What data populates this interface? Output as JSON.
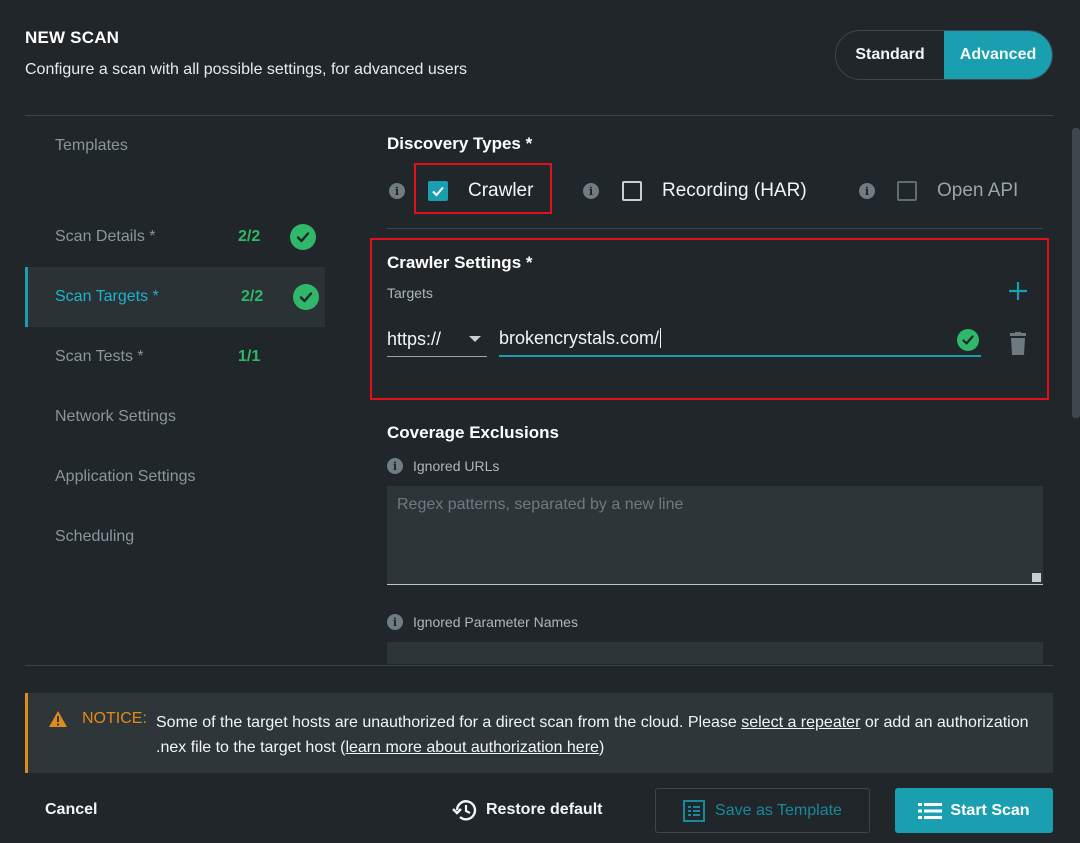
{
  "header": {
    "title": "NEW SCAN",
    "subtitle": "Configure a scan with all possible settings, for advanced users"
  },
  "mode": {
    "standard": "Standard",
    "advanced": "Advanced",
    "selected": "Advanced"
  },
  "sidebar": {
    "templates_label": "Templates",
    "items": [
      {
        "label": "Scan Details *",
        "count": "2/2",
        "complete": true
      },
      {
        "label": "Scan Targets *",
        "count": "2/2",
        "complete": true,
        "active": true
      },
      {
        "label": "Scan Tests *",
        "count": "1/1",
        "complete": false
      },
      {
        "label": "Network Settings"
      },
      {
        "label": "Application Settings"
      },
      {
        "label": "Scheduling"
      }
    ]
  },
  "discovery": {
    "title": "Discovery Types *",
    "options": [
      {
        "label": "Crawler",
        "checked": true,
        "enabled": true
      },
      {
        "label": "Recording (HAR)",
        "checked": false,
        "enabled": true
      },
      {
        "label": "Open API",
        "checked": false,
        "enabled": false
      }
    ]
  },
  "crawler": {
    "title": "Crawler Settings *",
    "targets_label": "Targets",
    "protocol": "https://",
    "url": "brokencrystals.com/"
  },
  "coverage": {
    "title": "Coverage Exclusions",
    "ignored_urls_label": "Ignored URLs",
    "ignored_urls_placeholder": "Regex patterns, separated by a new line",
    "ignored_params_label": "Ignored Parameter Names"
  },
  "notice": {
    "tag": "NOTICE:",
    "text_before": "Some of the target hosts are unauthorized for a direct scan from the cloud. Please ",
    "link1": "select a repeater",
    "text_middle": " or add an authorization .nex file to the target host (",
    "link2": "learn more about authorization here",
    "text_after": ")"
  },
  "footer": {
    "cancel": "Cancel",
    "restore": "Restore default",
    "save_template": "Save as Template",
    "start_scan": "Start Scan"
  },
  "colors": {
    "accent": "#1a9fb1",
    "success": "#2fb86a",
    "warning": "#e08a1a",
    "highlight": "#e0111c",
    "background": "#202629"
  }
}
